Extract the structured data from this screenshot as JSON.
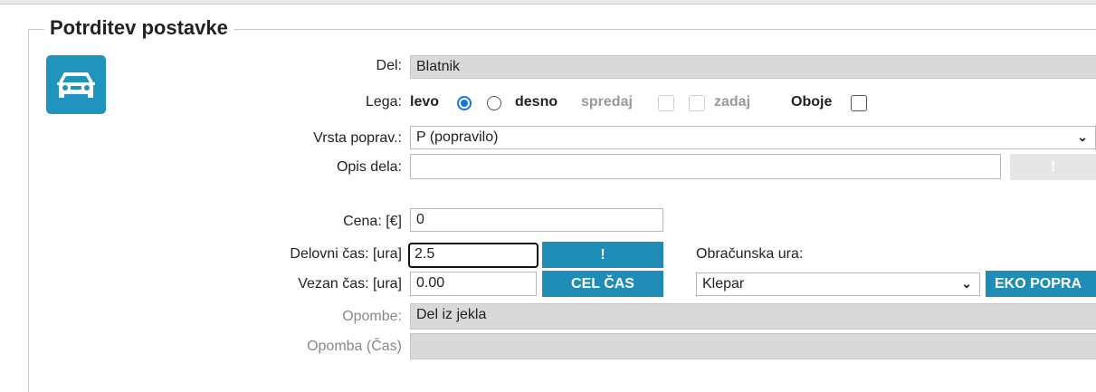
{
  "section": {
    "title": "Potrditev postavke",
    "icon": "car-icon"
  },
  "fields": {
    "del": {
      "label": "Del:",
      "value": "Blatnik"
    },
    "lega": {
      "label": "Lega:",
      "left": "levo",
      "right": "desno",
      "front": "spredaj",
      "back": "zadaj",
      "both": "Oboje",
      "selected": "levo"
    },
    "vrsta": {
      "label": "Vrsta poprav.:",
      "value": "P (popravilo)"
    },
    "opis": {
      "label": "Opis dela:",
      "value": "",
      "button": "!"
    },
    "cena": {
      "label": "Cena: [€]",
      "value": "0"
    },
    "delovni": {
      "label": "Delovni čas: [ura]",
      "value": "2.5",
      "button": "!"
    },
    "vezan": {
      "label": "Vezan čas: [ura]",
      "value": "0.00",
      "button": "CEL ČAS"
    },
    "obracunska": {
      "label": "Obračunska ura:",
      "value": "Klepar",
      "button": "EKO POPRA"
    },
    "opombe": {
      "label": "Opombe:",
      "value": "Del iz jekla"
    },
    "opomba_cas": {
      "label": "Opomba (Čas)",
      "value": ""
    }
  },
  "colors": {
    "accent": "#1f8db5",
    "readonly_bg": "#d9d9d9",
    "radio_selected": "#1a73e8"
  }
}
